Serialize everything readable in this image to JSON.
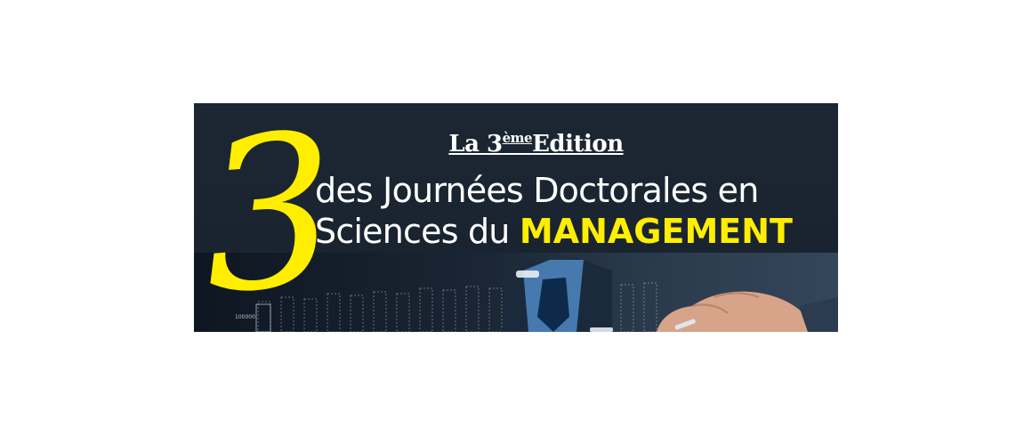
{
  "banner": {
    "edition_prefix": "La 3",
    "edition_sup": "ème",
    "edition_suffix": "Edition",
    "line1": "des Journées Doctorales en",
    "line2_prefix": "Sciences du",
    "line2_highlight": "MANAGEMENT",
    "big_numeral": "3",
    "chart_tick": "100000"
  },
  "colors": {
    "background": "#1c2733",
    "highlight": "#ffee00",
    "text": "#ffffff"
  }
}
